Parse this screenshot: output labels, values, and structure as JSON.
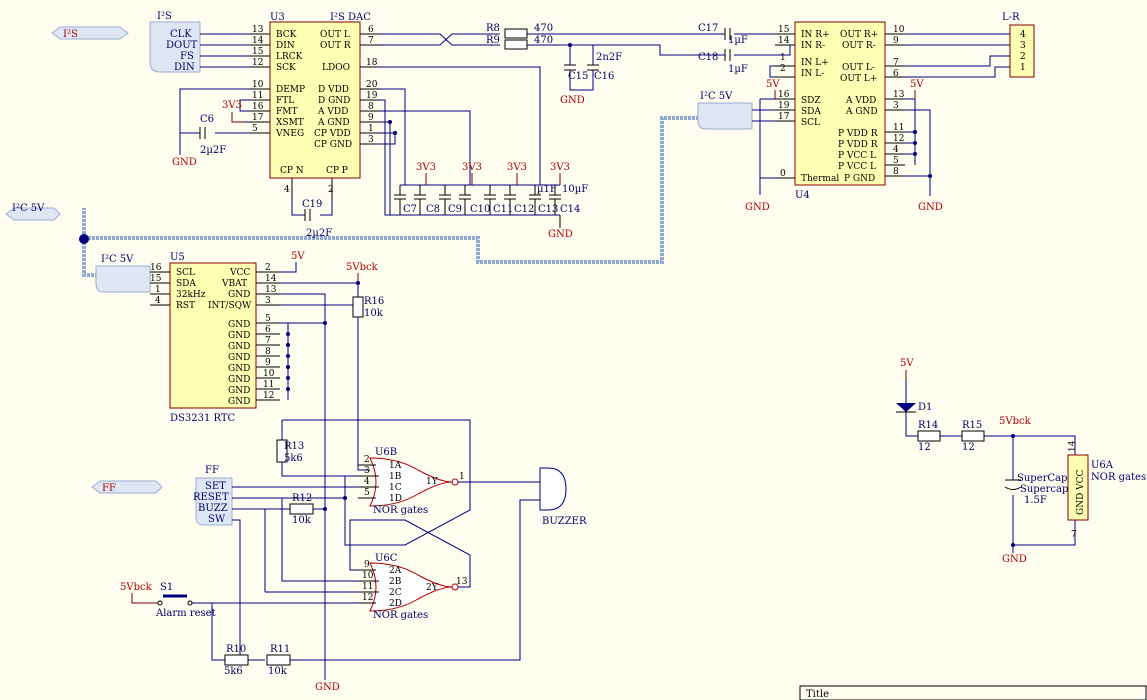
{
  "title_block": {
    "label": "Title"
  },
  "ports": {
    "i2s_bus": "I²S",
    "i2c_bus_left": "I²C 5V",
    "ff_bus": "FF",
    "i2c_u5": "I²C 5V",
    "i2c_u4": "I²C 5V",
    "i2s_group": "I²S",
    "ff_group": "FF"
  },
  "i2s_signals": [
    "CLK",
    "DOUT",
    "FS",
    "DIN"
  ],
  "ff_signals": [
    "SET",
    "RESET",
    "BUZZ",
    "SW"
  ],
  "u3": {
    "ref": "U3",
    "name": "I²S DAC",
    "left_pins": [
      {
        "num": "13",
        "name": "BCK"
      },
      {
        "num": "14",
        "name": "DIN"
      },
      {
        "num": "15",
        "name": "LRCK"
      },
      {
        "num": "12",
        "name": "SCK"
      },
      {
        "num": "10",
        "name": "DEMP"
      },
      {
        "num": "11",
        "name": "FTL"
      },
      {
        "num": "16",
        "name": "FMT"
      },
      {
        "num": "17",
        "name": "XSMT"
      },
      {
        "num": "5",
        "name": "VNEG"
      }
    ],
    "right_pins": [
      {
        "num": "6",
        "name": "OUT L"
      },
      {
        "num": "7",
        "name": "OUT R"
      },
      {
        "num": "18",
        "name": "LDOO"
      },
      {
        "num": "20",
        "name": "D VDD"
      },
      {
        "num": "19",
        "name": "D GND"
      },
      {
        "num": "8",
        "name": "A VDD"
      },
      {
        "num": "9",
        "name": "A GND"
      },
      {
        "num": "1",
        "name": "CP VDD"
      },
      {
        "num": "3",
        "name": "CP GND"
      }
    ],
    "bottom_pins": [
      {
        "num": "4",
        "name": "CP N"
      },
      {
        "num": "2",
        "name": "CP P"
      }
    ]
  },
  "u4": {
    "ref": "U4",
    "left_pins": [
      {
        "num": "15",
        "name": "IN R+"
      },
      {
        "num": "14",
        "name": "IN R-"
      },
      {
        "num": "1",
        "name": "IN L+"
      },
      {
        "num": "2",
        "name": "IN L-"
      },
      {
        "num": "16",
        "name": "SDZ"
      },
      {
        "num": "19",
        "name": "SDA"
      },
      {
        "num": "17",
        "name": "SCL"
      },
      {
        "num": "0",
        "name": "Thermal"
      }
    ],
    "right_pins": [
      {
        "num": "10",
        "name": "OUT R+"
      },
      {
        "num": "9",
        "name": "OUT R-"
      },
      {
        "num": "7",
        "name": "OUT L-"
      },
      {
        "num": "6",
        "name": "OUT L+"
      },
      {
        "num": "13",
        "name": "A VDD"
      },
      {
        "num": "3",
        "name": "A GND"
      },
      {
        "num": "11",
        "name": "P VDD R"
      },
      {
        "num": "12",
        "name": "P VDD R"
      },
      {
        "num": "4",
        "name": "P VCC L"
      },
      {
        "num": "5",
        "name": "P VCC L"
      },
      {
        "num": "8",
        "name": "P GND"
      }
    ]
  },
  "u5": {
    "ref": "U5",
    "name": "DS3231 RTC",
    "left_pins": [
      {
        "num": "16",
        "name": "SCL"
      },
      {
        "num": "15",
        "name": "SDA"
      },
      {
        "num": "1",
        "name": "32kHz"
      },
      {
        "num": "4",
        "name": "RST"
      }
    ],
    "right_pins": [
      {
        "num": "2",
        "name": "VCC"
      },
      {
        "num": "14",
        "name": "VBAT"
      },
      {
        "num": "13",
        "name": "GND"
      },
      {
        "num": "3",
        "name": "INT/SQW"
      },
      {
        "num": "5",
        "name": "GND"
      },
      {
        "num": "6",
        "name": "GND"
      },
      {
        "num": "7",
        "name": "GND"
      },
      {
        "num": "8",
        "name": "GND"
      },
      {
        "num": "9",
        "name": "GND"
      },
      {
        "num": "10",
        "name": "GND"
      },
      {
        "num": "11",
        "name": "GND"
      },
      {
        "num": "12",
        "name": "GND"
      }
    ]
  },
  "connector": {
    "ref": "L-R",
    "pins": [
      "4",
      "3",
      "2",
      "1"
    ]
  },
  "u6b": {
    "ref": "U6B",
    "inputs": [
      "1A",
      "1B",
      "1C",
      "1D"
    ],
    "pin_nums": [
      "2",
      "3",
      "4",
      "5"
    ],
    "output": "1Y",
    "out_pin": "1",
    "label": "NOR gates"
  },
  "u6c": {
    "ref": "U6C",
    "inputs": [
      "2A",
      "2B",
      "2C",
      "2D"
    ],
    "pin_nums": [
      "9",
      "10",
      "11",
      "12"
    ],
    "output": "2Y",
    "out_pin": "13",
    "label": "NOR gates"
  },
  "u6a": {
    "ref": "U6A",
    "name": "NOR gates",
    "body": "GND VCC",
    "pin_top": "14",
    "pin_bottom": "7"
  },
  "resistors": {
    "r8": {
      "ref": "R8",
      "value": "470"
    },
    "r9": {
      "ref": "R9",
      "value": "470"
    },
    "r16": {
      "ref": "R16",
      "value": "10k"
    },
    "r13": {
      "ref": "R13",
      "value": "5k6"
    },
    "r12": {
      "ref": "R12",
      "value": "10k"
    },
    "r10": {
      "ref": "R10",
      "value": "5k6"
    },
    "r11": {
      "ref": "R11",
      "value": "10k"
    },
    "r14": {
      "ref": "R14",
      "value": "12"
    },
    "r15": {
      "ref": "R15",
      "value": "12"
    }
  },
  "caps": {
    "c6": {
      "ref": "C6",
      "value": "2µ2F"
    },
    "c19": {
      "ref": "C19",
      "value": "2µ2F"
    },
    "c15": "C15",
    "c16": "C16",
    "c15_16_value": "2n2F",
    "c17": {
      "ref": "C17",
      "value": "1µF"
    },
    "c18": {
      "ref": "C18",
      "value": "1µF"
    },
    "bank": [
      "C7",
      "C8",
      "C9",
      "C10",
      "C11",
      "C12",
      "C13",
      "C14"
    ],
    "bank_values": [
      "µ1F",
      "10µF"
    ],
    "supercap": {
      "ref": "SuperCap",
      "name": "Supercap",
      "value": "1.5F"
    }
  },
  "power": {
    "gnd": "GND",
    "v33": "3V3",
    "v5": "5V",
    "v5bck": "5Vbck"
  },
  "misc": {
    "d1": "D1",
    "s1": "S1",
    "s1_label": "Alarm reset",
    "buzzer": "BUZZER"
  }
}
